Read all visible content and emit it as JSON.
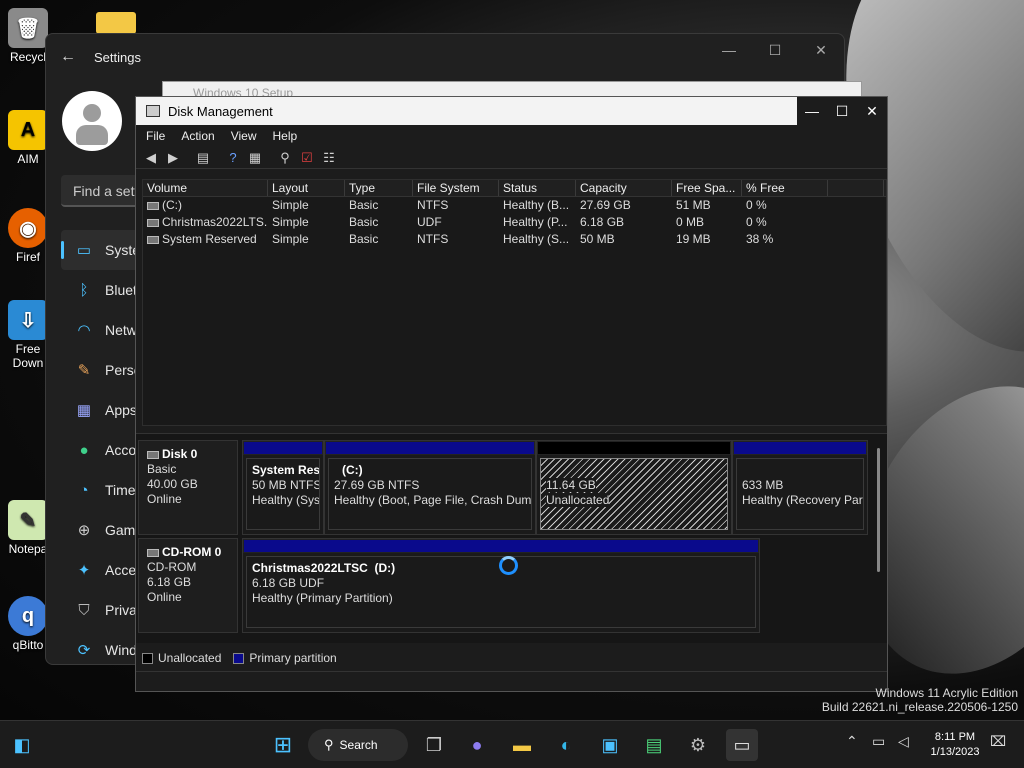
{
  "desktop": {
    "icons": [
      {
        "label": "Recycl",
        "icon": "recycle-bin-icon"
      },
      {
        "label": "AIM",
        "icon": "aim-icon"
      },
      {
        "label": "Firef",
        "icon": "firefox-icon"
      },
      {
        "label": "Free Down",
        "icon": "download-icon"
      },
      {
        "label": "Notepa",
        "icon": "notepad-icon"
      },
      {
        "label": "qBitto",
        "icon": "qbittorrent-icon"
      }
    ],
    "edition_line1": "Windows 11 Acrylic Edition",
    "edition_line2": "Build 22621.ni_release.220506-1250"
  },
  "settings": {
    "title": "Settings",
    "search_placeholder": "Find a setti",
    "nav": [
      {
        "label": "Syste",
        "icon": "monitor-icon",
        "color": "#4cc2ff"
      },
      {
        "label": "Bluet",
        "icon": "bluetooth-icon",
        "color": "#4cc2ff"
      },
      {
        "label": "Netw",
        "icon": "wifi-icon",
        "color": "#4cc2ff"
      },
      {
        "label": "Perso",
        "icon": "brush-icon",
        "color": "#e8a35a"
      },
      {
        "label": "Apps",
        "icon": "apps-icon",
        "color": "#9aa7ff"
      },
      {
        "label": "Acco",
        "icon": "person-icon",
        "color": "#3fd18b"
      },
      {
        "label": "Time",
        "icon": "globe-clock-icon",
        "color": "#4cc2ff"
      },
      {
        "label": "Gami",
        "icon": "gamepad-icon",
        "color": "#cccccc"
      },
      {
        "label": "Acces",
        "icon": "accessibility-icon",
        "color": "#4cc2ff"
      },
      {
        "label": "Priva",
        "icon": "shield-icon",
        "color": "#bbbbbb"
      },
      {
        "label": "Wind",
        "icon": "update-icon",
        "color": "#4cc2ff"
      }
    ]
  },
  "setup": {
    "title": "Windows 10 Setup"
  },
  "diskmgmt": {
    "title": "Disk Management",
    "menu": [
      "File",
      "Action",
      "View",
      "Help"
    ],
    "columns": [
      "Volume",
      "Layout",
      "Type",
      "File System",
      "Status",
      "Capacity",
      "Free Spa...",
      "% Free",
      ""
    ],
    "rows": [
      [
        "(C:)",
        "Simple",
        "Basic",
        "NTFS",
        "Healthy (B...",
        "27.69 GB",
        "51 MB",
        "0 %"
      ],
      [
        "Christmas2022LTS...",
        "Simple",
        "Basic",
        "UDF",
        "Healthy (P...",
        "6.18 GB",
        "0 MB",
        "0 %"
      ],
      [
        "System Reserved",
        "Simple",
        "Basic",
        "NTFS",
        "Healthy (S...",
        "50 MB",
        "19 MB",
        "38 %"
      ]
    ],
    "disk0": {
      "name": "Disk 0",
      "type": "Basic",
      "size": "40.00 GB",
      "state": "Online",
      "partitions": [
        {
          "title": "System Res",
          "line2": "50 MB NTFS",
          "line3": "Healthy (Sys"
        },
        {
          "title": "(C:)",
          "line2": "27.69 GB NTFS",
          "line3": "Healthy (Boot, Page File, Crash Dump"
        },
        {
          "title": "",
          "line2": "11.64 GB",
          "line3": "Unallocated"
        },
        {
          "title": "",
          "line2": "633 MB",
          "line3": "Healthy (Recovery Part"
        }
      ]
    },
    "cdrom0": {
      "name": "CD-ROM 0",
      "type": "CD-ROM",
      "size": "6.18 GB",
      "state": "Online",
      "partition": {
        "title": "Christmas2022LTSC  (D:)",
        "line2": "6.18 GB UDF",
        "line3": "Healthy (Primary Partition)"
      }
    },
    "legend": [
      {
        "label": "Unallocated",
        "color": "#000000"
      },
      {
        "label": "Primary partition",
        "color": "#0a0a8c"
      }
    ]
  },
  "taskbar": {
    "search_label": "Search",
    "time": "8:11 PM",
    "date": "1/13/2023"
  }
}
